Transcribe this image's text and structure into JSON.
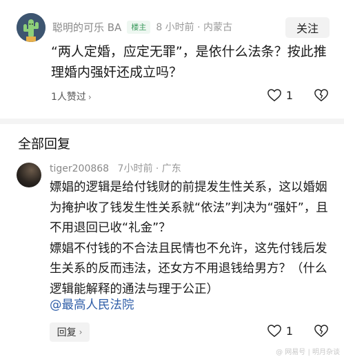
{
  "op": {
    "username": "聪明的可乐 BA",
    "badge": "楼主",
    "meta": "8 小时前 · 内蒙古",
    "follow_label": "关注",
    "text": "“两人定婚，应定无罪”，是依什么法条？按此推理婚内强奸还成立吗？",
    "likes_text": "1人赞过",
    "like_count": "1"
  },
  "section_title": "全部回复",
  "reply": {
    "username": "tiger200868",
    "meta": "7小时前 · 广东",
    "paragraph1": "嫖娼的逻辑是给付钱财的前提发生性关系，这以婚姻为掩护收了钱发生性关系就“依法”判决为“强奸”，且不用退回已收“礼金”？",
    "paragraph2": "嫖娼不付钱的不合法且民情也不允许，这先付钱后发生关系的反而违法，还女方不用退钱给男方？（什么逻辑能解释的通法与理于公正）",
    "mention": "@最高人民法院",
    "reply_label": "回复",
    "like_count": "1"
  },
  "watermark": "@ 网易号 | 明月杂谈",
  "colors": {
    "badge_green": "#3a9a5c",
    "mention_blue": "#2f5ea8",
    "avatar_op": "#3d5570"
  }
}
